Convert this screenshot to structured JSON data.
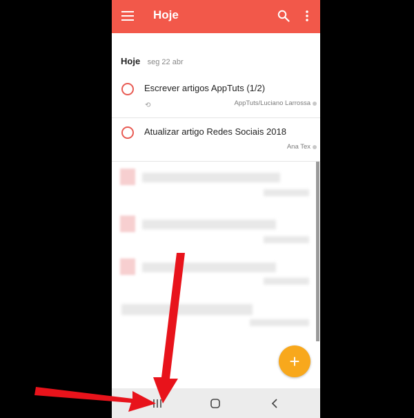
{
  "app": {
    "title": "Hoje",
    "date_heading": "Hoje",
    "date_sub": "seg 22 abr"
  },
  "tasks": [
    {
      "name": "Escrever artigos AppTuts (1/2)",
      "project": "AppTuts/Luciano Larrossa",
      "recurring": true
    },
    {
      "name": "Atualizar artigo Redes Sociais 2018",
      "project": "Ana Tex",
      "recurring": false
    }
  ],
  "fab": {
    "label": "+"
  },
  "icons": {
    "menu": "hamburger-menu-icon",
    "search": "search-icon",
    "more": "more-vert-icon",
    "recurring": "repeat-icon",
    "nav_recent": "recent-apps-icon",
    "nav_home": "home-icon",
    "nav_back": "back-icon"
  },
  "colors": {
    "appbar": "#f2584a",
    "fab": "#f8a81c",
    "arrow": "#e8131b",
    "task_circle": "#e85b53"
  }
}
